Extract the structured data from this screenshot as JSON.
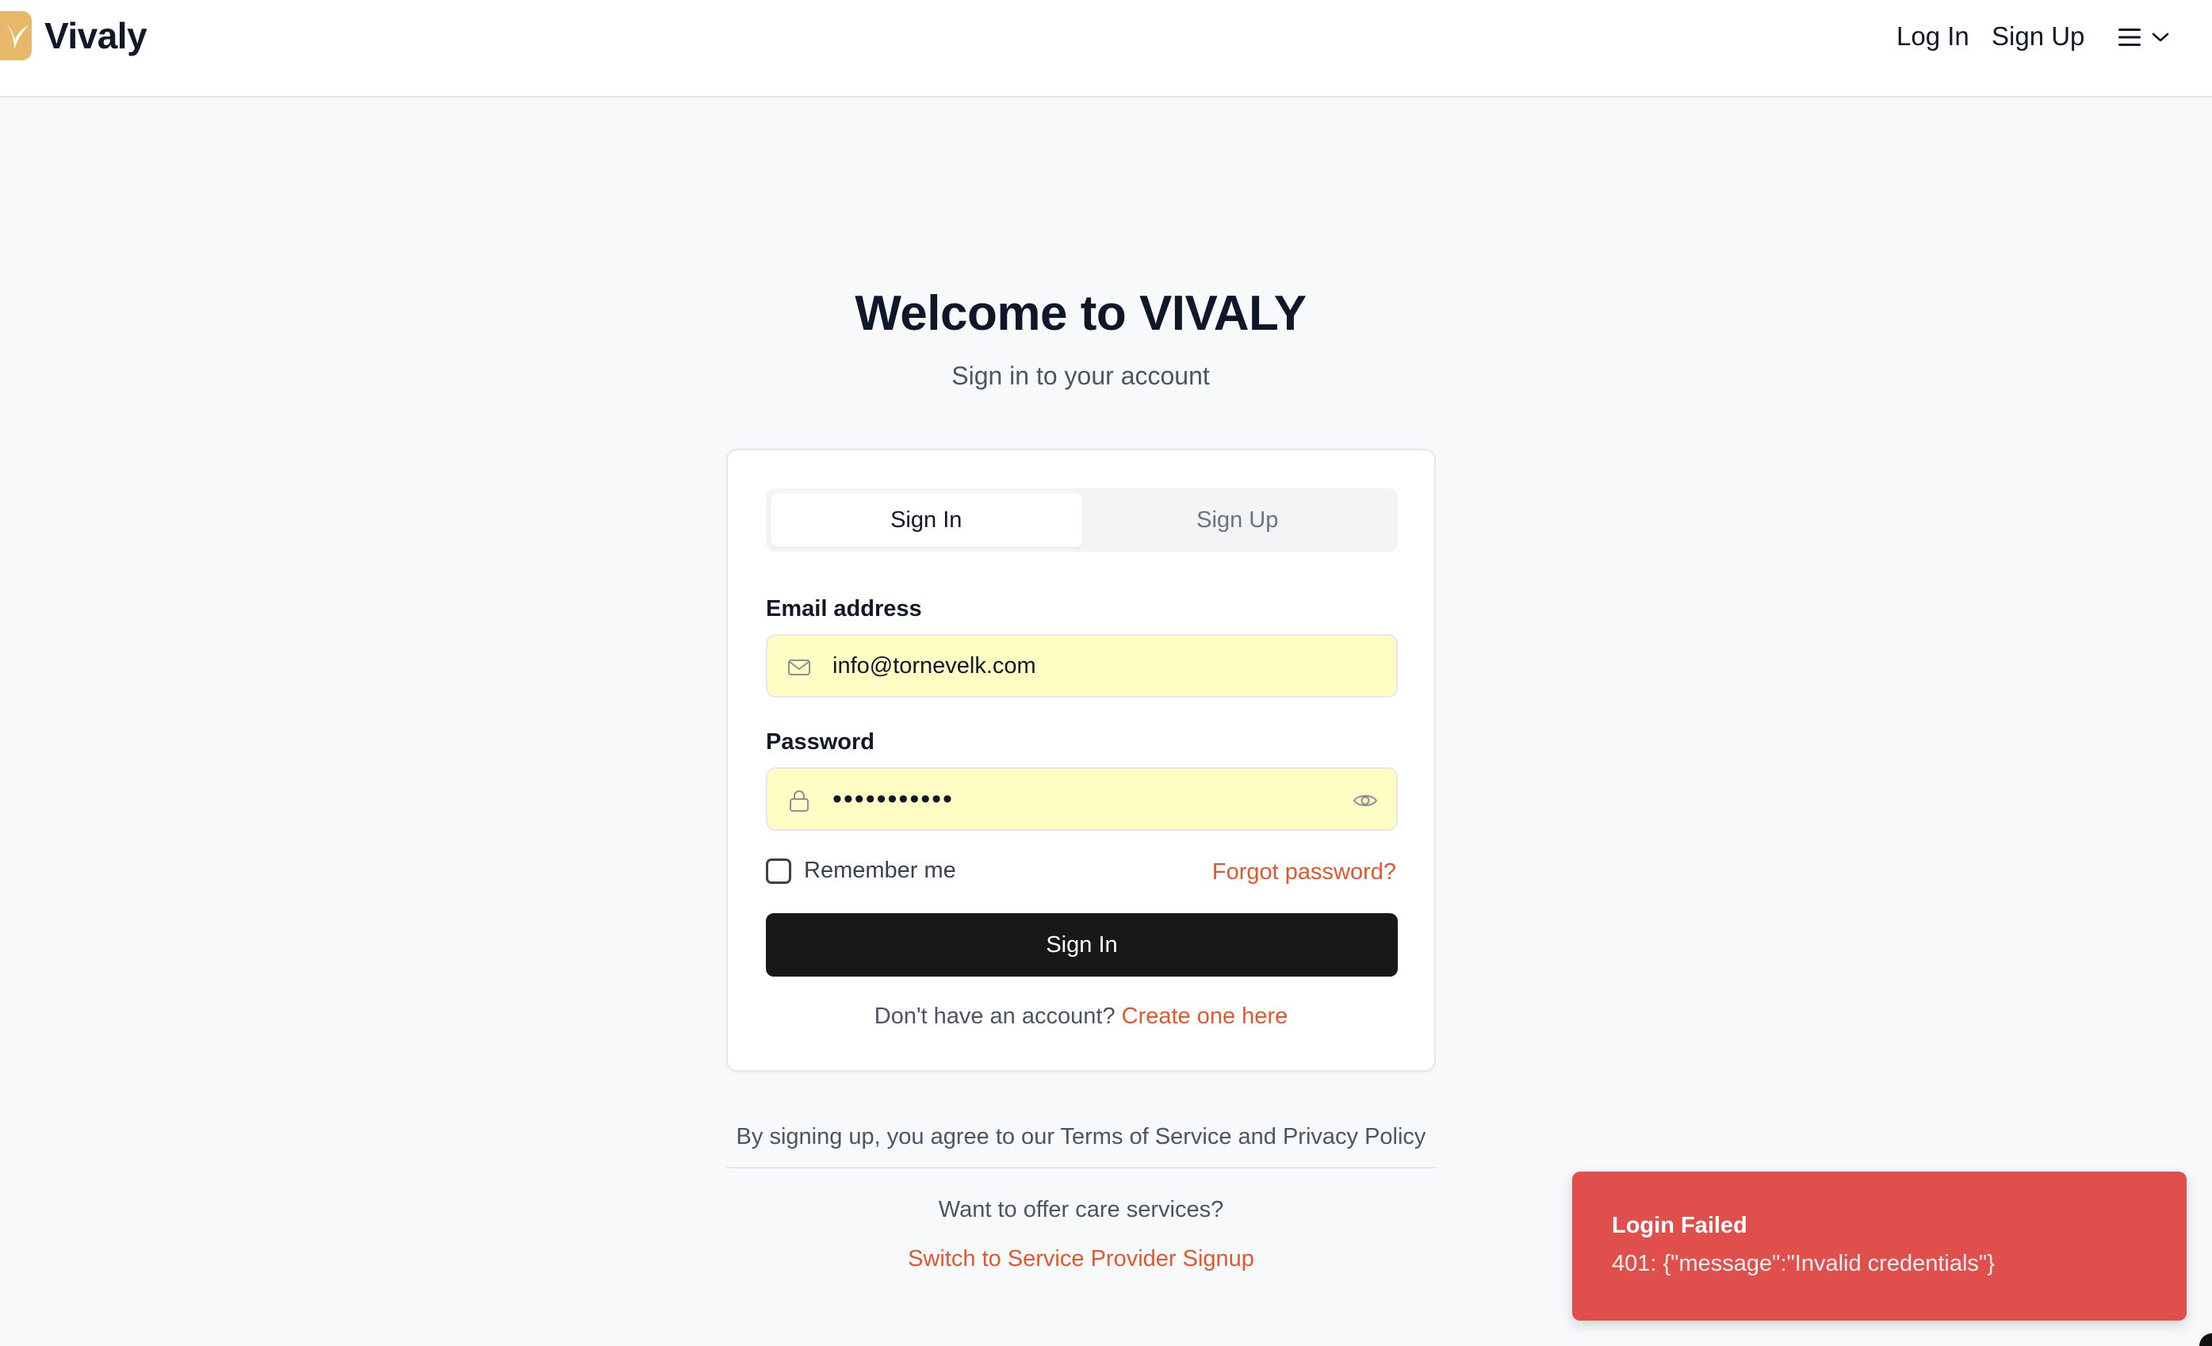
{
  "header": {
    "brand": "Vivaly",
    "nav": {
      "login": "Log In",
      "signup": "Sign Up"
    }
  },
  "hero": {
    "title": "Welcome to VIVALY",
    "subtitle": "Sign in to your account"
  },
  "form": {
    "tabs": [
      {
        "label": "Sign In",
        "active": true
      },
      {
        "label": "Sign Up",
        "active": false
      }
    ],
    "email": {
      "label": "Email address",
      "value": "info@tornevelk.com"
    },
    "password": {
      "label": "Password",
      "value": "•••••••••••"
    },
    "remember_label": "Remember me",
    "remember_checked": false,
    "forgot_label": "Forgot password?",
    "submit_label": "Sign In",
    "no_account_text": "Don't have an account?",
    "create_link": "Create one here"
  },
  "footer": {
    "terms": "By signing up, you agree to our Terms of Service and Privacy Policy",
    "provider_question": "Want to offer care services?",
    "provider_link": "Switch to Service Provider Signup"
  },
  "toast": {
    "title": "Login Failed",
    "message": "401: {\"message\":\"Invalid credentials\"}",
    "color": "#e04f4c"
  },
  "colors": {
    "accent": "#e4572e",
    "autofill": "#fefdc3",
    "primary_button": "#18181b",
    "brand_logo": "#e8b86a"
  },
  "icons": [
    "vivaly-logo-icon",
    "menu-icon",
    "chevron-down-icon",
    "mail-icon",
    "lock-icon",
    "eye-icon"
  ]
}
